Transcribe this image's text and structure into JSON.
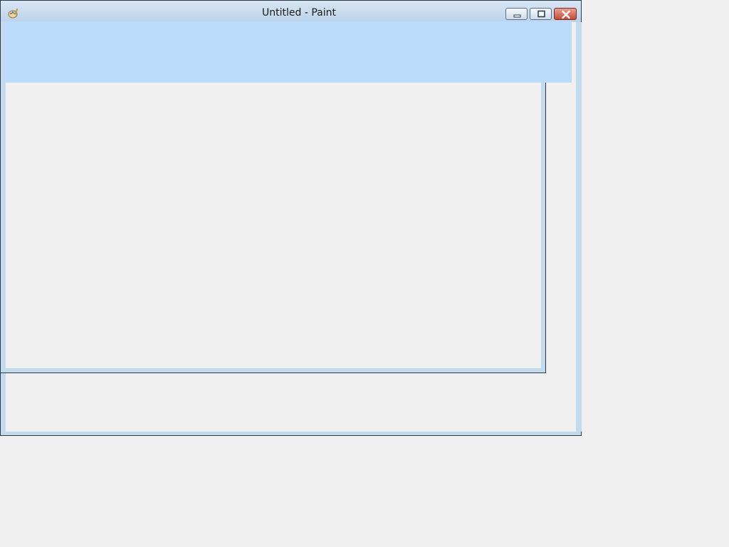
{
  "window": {
    "title": "Untitled - Paint",
    "app_icon": "paint-palette-icon"
  },
  "caption_buttons": {
    "minimize_icon": "minimize-icon",
    "maximize_icon": "maximize-icon",
    "close_icon": "close-icon"
  },
  "colors": {
    "frame": "#c3d9ee",
    "ribbon": "#bcdaf9",
    "background": "#f0f0f0",
    "close_button": "#c64a3a"
  }
}
